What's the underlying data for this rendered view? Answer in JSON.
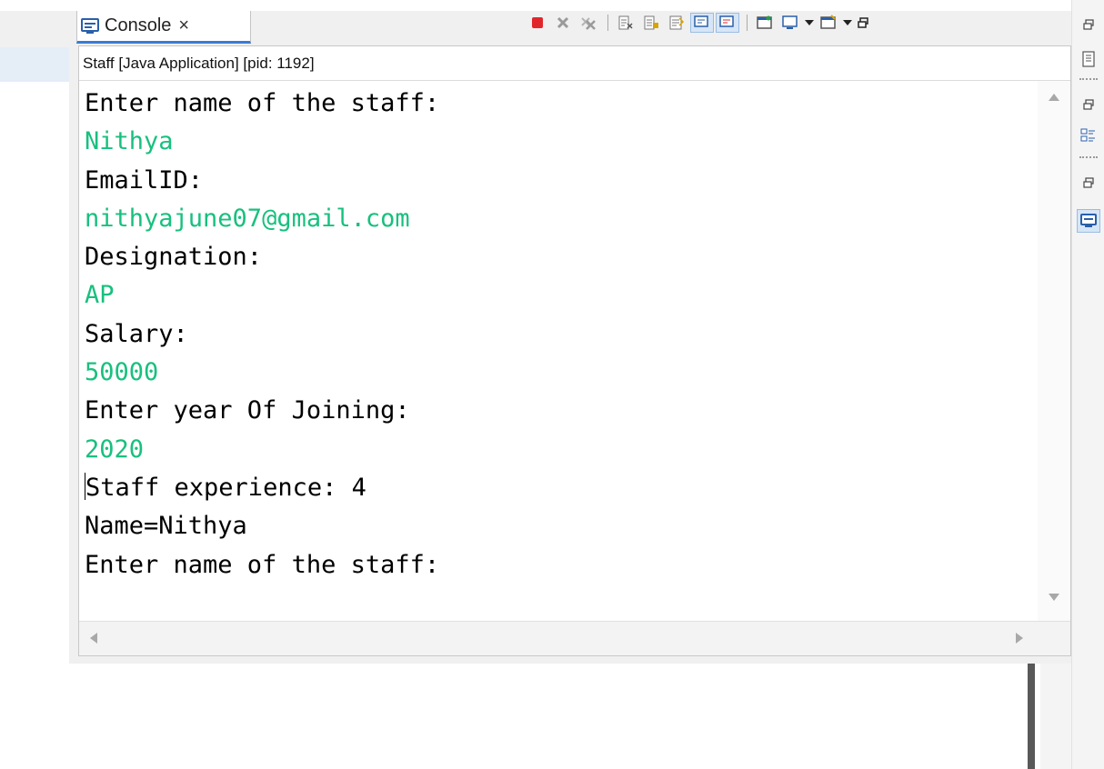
{
  "console": {
    "tab_label": "Console",
    "close_glyph": "×",
    "process_label": "Staff [Java Application]  [pid: 1192]"
  },
  "output": {
    "lines": [
      {
        "text": "Enter name of the staff:",
        "kind": "out"
      },
      {
        "text": "Nithya",
        "kind": "in"
      },
      {
        "text": "EmailID:",
        "kind": "out"
      },
      {
        "text": "nithyajune07@gmail.com",
        "kind": "in"
      },
      {
        "text": "Designation:",
        "kind": "out"
      },
      {
        "text": "AP",
        "kind": "in"
      },
      {
        "text": "Salary:",
        "kind": "out"
      },
      {
        "text": "50000",
        "kind": "in"
      },
      {
        "text": "Enter year Of Joining:",
        "kind": "out"
      },
      {
        "text": "2020",
        "kind": "in"
      },
      {
        "text": "Staff experience: 4",
        "kind": "out"
      },
      {
        "text": "Name=Nithya",
        "kind": "out"
      },
      {
        "text": "Enter name of the staff:",
        "kind": "out"
      }
    ]
  },
  "toolbar": {
    "icons": [
      "terminate-icon",
      "remove-launch-icon",
      "remove-all-terminated-icon",
      "clear-console-icon",
      "scroll-lock-icon",
      "word-wrap-icon",
      "show-on-stdout-icon",
      "show-on-stderr-icon",
      "pin-console-icon",
      "display-selected-console-icon",
      "open-console-icon",
      "minimize-icon"
    ]
  },
  "colors": {
    "stdout": "#000000",
    "stdin": "#18c07e",
    "terminate": "#e0262b",
    "tab_accent": "#3a7ad4"
  }
}
